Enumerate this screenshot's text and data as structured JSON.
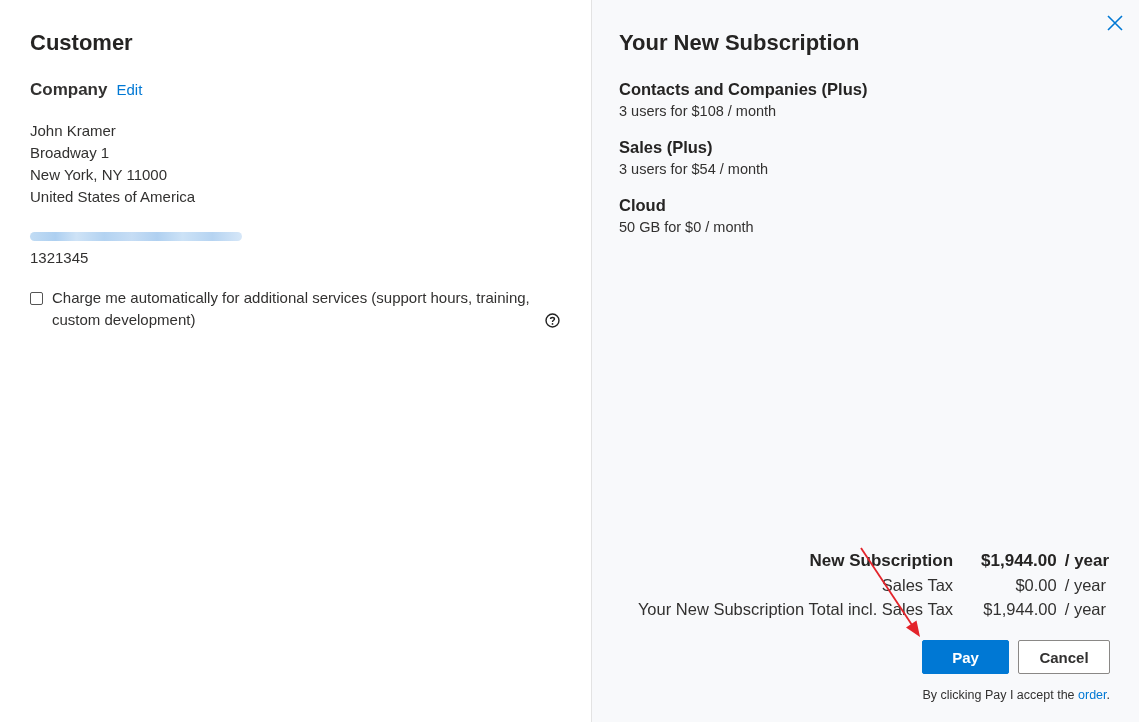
{
  "customer": {
    "title": "Customer",
    "company_label": "Company",
    "edit_link": "Edit",
    "address_lines": [
      "John Kramer",
      "Broadway 1",
      "New York, NY 11000",
      "United States of America"
    ],
    "phone": "1321345",
    "auto_charge": {
      "label": "Charge me automatically for additional services (support hours, training, custom development)",
      "checked": false
    }
  },
  "subscription": {
    "title": "Your New Subscription",
    "items": [
      {
        "name": "Contacts and Companies (Plus)",
        "detail": "3 users for $108 / month"
      },
      {
        "name": "Sales (Plus)",
        "detail": "3 users for $54 / month"
      },
      {
        "name": "Cloud",
        "detail": "50 GB for $0 / month"
      }
    ],
    "summary": [
      {
        "label": "New Subscription",
        "amount": "$1,944.00",
        "unit": "/ year",
        "emphasized": true
      },
      {
        "label": "Sales Tax",
        "amount": "$0.00",
        "unit": "/ year",
        "emphasized": false
      },
      {
        "label": "Your New Subscription Total incl. Sales Tax",
        "amount": "$1,944.00",
        "unit": "/ year",
        "emphasized": false
      }
    ],
    "buttons": [
      {
        "label": "Pay",
        "kind": "primary"
      },
      {
        "label": "Cancel",
        "kind": "secondary"
      }
    ],
    "consent": {
      "text": "By clicking Pay I accept the",
      "link": "order",
      "end": "."
    }
  }
}
